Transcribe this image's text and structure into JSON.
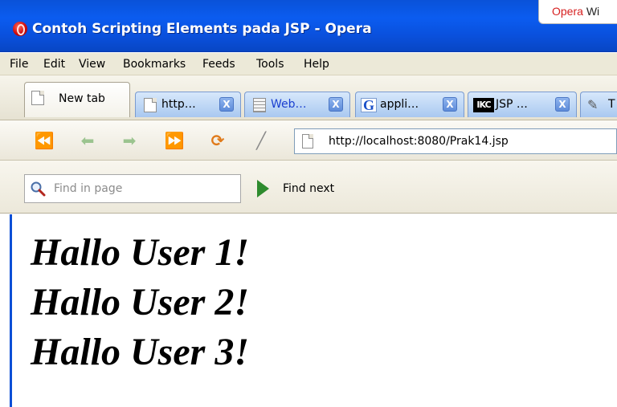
{
  "window": {
    "title": "Contoh Scripting Elements pada JSP - Opera",
    "popup_brand": "Opera",
    "popup_suffix": "Wi"
  },
  "menu": {
    "items": [
      "File",
      "Edit",
      "View",
      "Bookmarks",
      "Feeds",
      "Tools",
      "Help"
    ]
  },
  "tabs": [
    {
      "label": "New tab",
      "icon": "document-icon",
      "active": true
    },
    {
      "label": "http…",
      "icon": "document-icon",
      "active": false
    },
    {
      "label": "Web…",
      "icon": "grid-document-icon",
      "active": false
    },
    {
      "label": "appli…",
      "icon": "google-g-icon",
      "active": false
    },
    {
      "label": "JSP …",
      "icon": "ikc-icon",
      "active": false
    },
    {
      "label": "T",
      "icon": "pin-icon",
      "active": false
    }
  ],
  "tab_icon_text": {
    "google": "G",
    "ikc": "IKC"
  },
  "tab_close_symbol": "X",
  "navigation": {
    "url": "http://localhost:8080/Prak14.jsp"
  },
  "find": {
    "placeholder": "Find in page",
    "value": "",
    "next_label": "Find next"
  },
  "content": {
    "greetings": [
      "Hallo User 1!",
      "Hallo User 2!",
      "Hallo User 3!"
    ]
  },
  "colors": {
    "titlebar": "#0b5cf0",
    "tab_inactive": "#a9c8f0",
    "greeting_text": "#000000"
  }
}
